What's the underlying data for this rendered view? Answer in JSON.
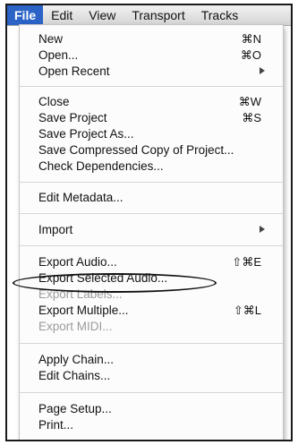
{
  "menubar": {
    "items": [
      "File",
      "Edit",
      "View",
      "Transport",
      "Tracks"
    ]
  },
  "file_menu": {
    "new": {
      "label": "New",
      "shortcut": "⌘N"
    },
    "open": {
      "label": "Open...",
      "shortcut": "⌘O"
    },
    "open_recent": {
      "label": "Open Recent"
    },
    "close": {
      "label": "Close",
      "shortcut": "⌘W"
    },
    "save_project": {
      "label": "Save Project",
      "shortcut": "⌘S"
    },
    "save_project_as": {
      "label": "Save Project As..."
    },
    "save_compressed": {
      "label": "Save Compressed Copy of Project..."
    },
    "check_dependencies": {
      "label": "Check Dependencies..."
    },
    "edit_metadata": {
      "label": "Edit Metadata..."
    },
    "import": {
      "label": "Import"
    },
    "export_audio": {
      "label": "Export Audio...",
      "shortcut": "⇧⌘E"
    },
    "export_selected_audio": {
      "label": "Export Selected Audio..."
    },
    "export_labels": {
      "label": "Export Labels..."
    },
    "export_multiple": {
      "label": "Export Multiple...",
      "shortcut": "⇧⌘L"
    },
    "export_midi": {
      "label": "Export MIDI..."
    },
    "apply_chain": {
      "label": "Apply Chain..."
    },
    "edit_chains": {
      "label": "Edit Chains..."
    },
    "page_setup": {
      "label": "Page Setup..."
    },
    "print": {
      "label": "Print..."
    }
  },
  "colors": {
    "menu_highlight": "#2b63c6",
    "disabled_text": "#9b9b9b"
  }
}
